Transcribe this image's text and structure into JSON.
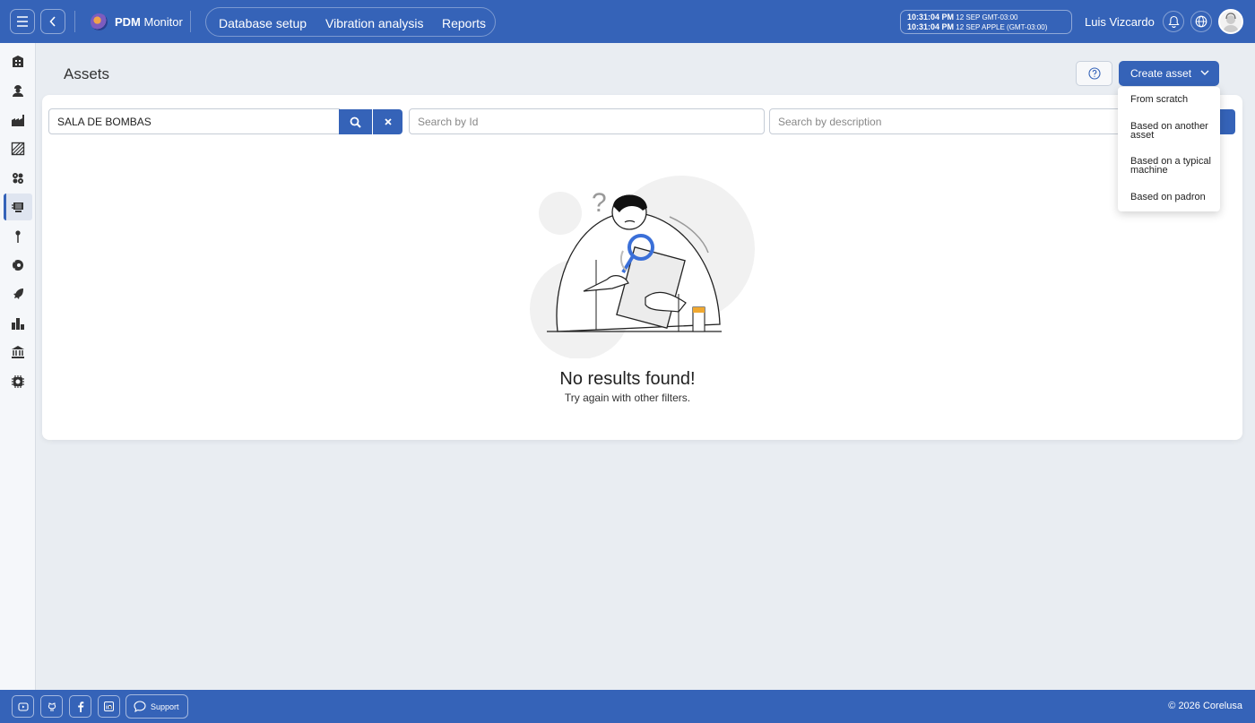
{
  "app": {
    "name_bold": "PDM",
    "name_rest": " Monitor"
  },
  "nav": {
    "items": [
      "Database setup",
      "Vibration analysis",
      "Reports"
    ]
  },
  "clock": {
    "line1_time": "10:31:04 PM",
    "line1_info": "12 SEP  GMT-03:00",
    "line2_time": "10:31:04 PM",
    "line2_info": "12 SEP  APPLE (GMT-03:00)"
  },
  "user": {
    "name": "Luis Vizcardo"
  },
  "page": {
    "title": "Assets",
    "create_label": "Create asset"
  },
  "filters": {
    "location_value": "SALA DE BOMBAS",
    "id_placeholder": "Search by Id",
    "description_placeholder": "Search by description"
  },
  "empty": {
    "title": "No results found!",
    "subtitle": "Try again with other filters."
  },
  "dropdown": {
    "items": [
      "From scratch",
      "Based on another asset",
      "Based on a typical machine",
      "Based on padron"
    ]
  },
  "footer": {
    "support_label": "Support",
    "copyright": "© 2026 Corelusa"
  },
  "colors": {
    "primary": "#3563b8",
    "background": "#e9edf2"
  }
}
